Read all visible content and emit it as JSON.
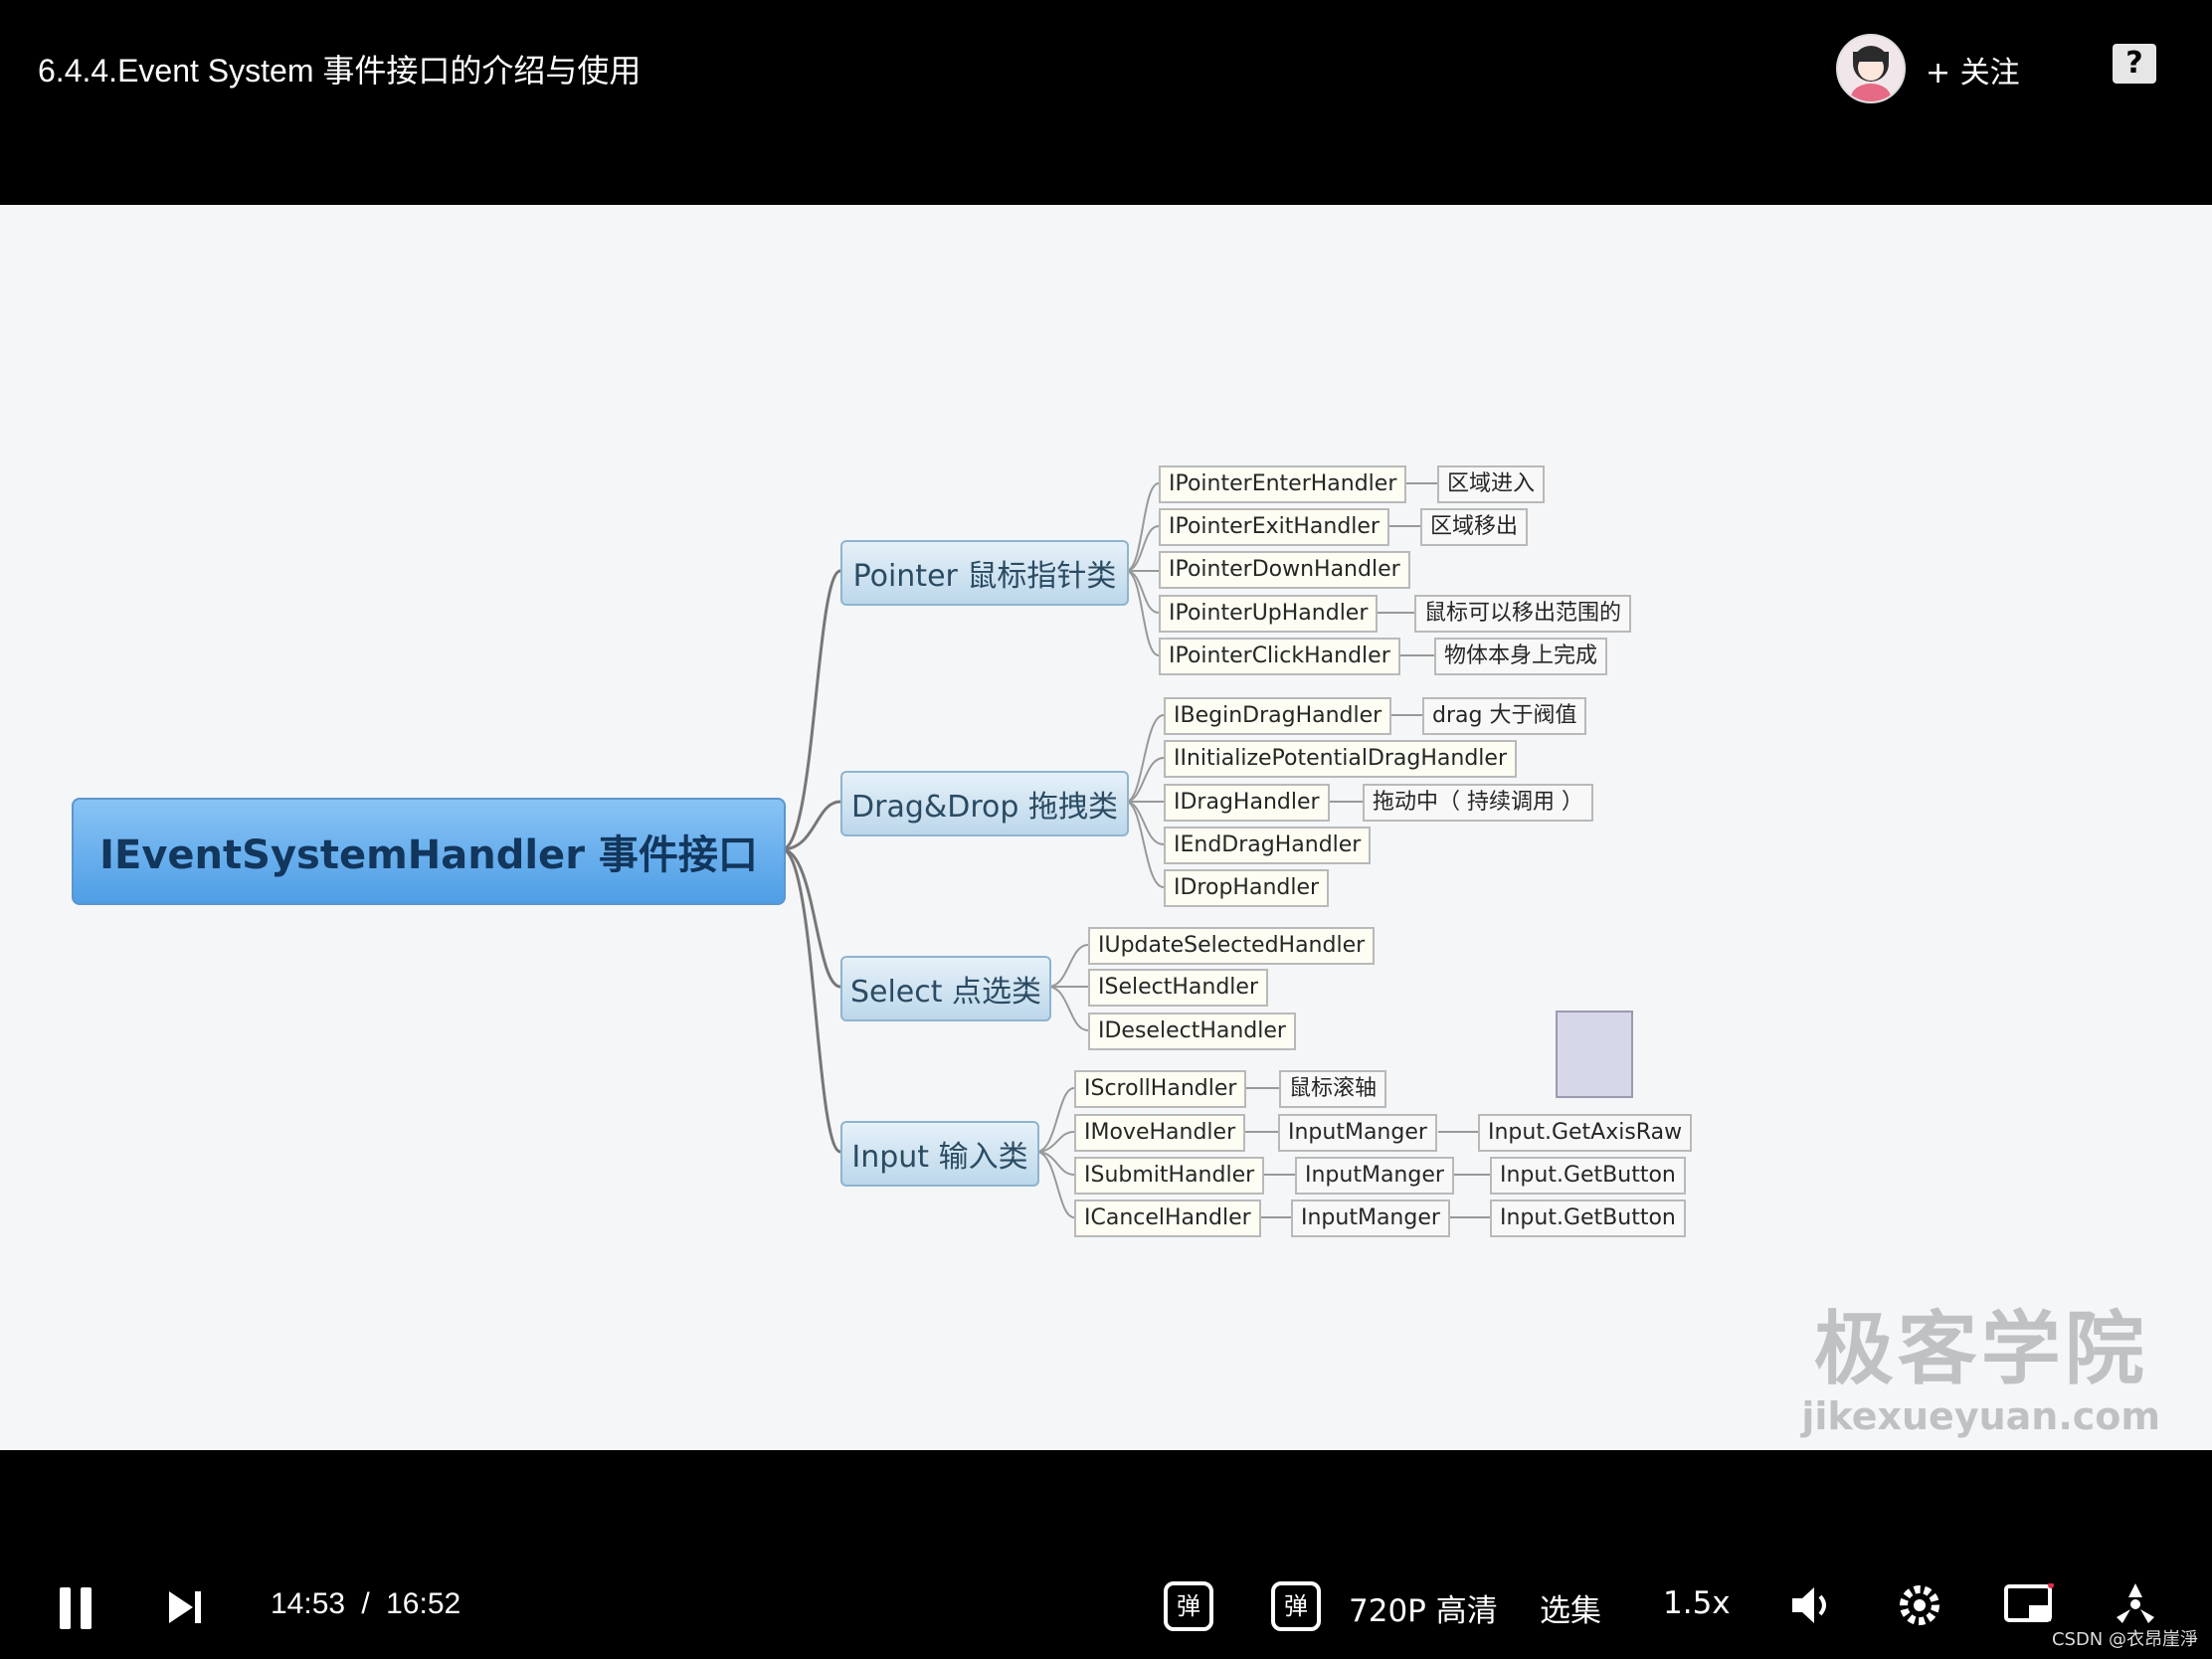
{
  "header": {
    "title": "6.4.4.Event System 事件接口的介绍与使用",
    "follow_label": "+ 关注",
    "help_icon": "?"
  },
  "mindmap": {
    "root": "IEventSystemHandler 事件接口",
    "branches": {
      "pointer": "Pointer 鼠标指针类",
      "drag": "Drag&Drop 拖拽类",
      "select": "Select 点选类",
      "input": "Input 输入类"
    },
    "pointer_items": [
      {
        "label": "IPointerEnterHandler",
        "note": "区域进入"
      },
      {
        "label": "IPointerExitHandler",
        "note": "区域移出"
      },
      {
        "label": "IPointerDownHandler",
        "note": ""
      },
      {
        "label": "IPointerUpHandler",
        "note": "鼠标可以移出范围的"
      },
      {
        "label": "IPointerClickHandler",
        "note": "物体本身上完成"
      }
    ],
    "drag_items": [
      {
        "label": "IBeginDragHandler",
        "note": "drag 大于阀值"
      },
      {
        "label": "IInitializePotentialDragHandler",
        "note": ""
      },
      {
        "label": "IDragHandler",
        "note": "拖动中（ 持续调用 ）"
      },
      {
        "label": "IEndDragHandler",
        "note": ""
      },
      {
        "label": "IDropHandler",
        "note": ""
      }
    ],
    "select_items": [
      {
        "label": "IUpdateSelectedHandler"
      },
      {
        "label": "ISelectHandler"
      },
      {
        "label": "IDeselectHandler"
      }
    ],
    "input_items": [
      {
        "label": "IScrollHandler",
        "note": "鼠标滚轴",
        "note2": ""
      },
      {
        "label": "IMoveHandler",
        "note": "InputManger",
        "note2": "Input.GetAxisRaw"
      },
      {
        "label": "ISubmitHandler",
        "note": "InputManger",
        "note2": "Input.GetButton"
      },
      {
        "label": "ICancelHandler",
        "note": "InputManger",
        "note2": "Input.GetButton"
      }
    ]
  },
  "watermark": {
    "logo": "极客学院",
    "url": "jikexueyuan.com"
  },
  "controls": {
    "current_time": "14:53",
    "separator": "/",
    "total_time": "16:52",
    "danmaku_label": "弹",
    "danmaku_settings_label": "弹",
    "quality": "720P 高清",
    "episodes": "选集",
    "speed": "1.5x"
  },
  "footer": {
    "credit": "CSDN @衣昂崖淨"
  }
}
